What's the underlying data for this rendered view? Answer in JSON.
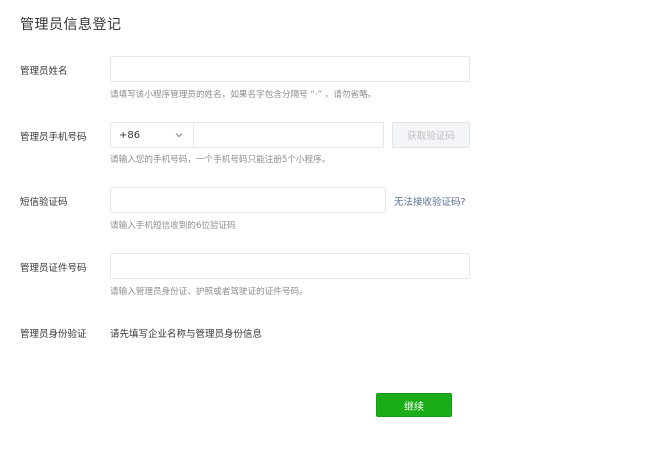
{
  "page": {
    "title": "管理员信息登记"
  },
  "form": {
    "name": {
      "label": "管理员姓名",
      "value": "",
      "hint": "请填写该小程序管理员的姓名，如果名字包含分隔号 “·” ，请勿省略。"
    },
    "phone": {
      "label": "管理员手机号码",
      "country_code": "+86",
      "value": "",
      "get_code_button": "获取验证码",
      "hint": "请输入您的手机号码，一个手机号码只能注册5个小程序。"
    },
    "sms": {
      "label": "短信验证码",
      "value": "",
      "cannot_receive_link": "无法接收验证码?",
      "hint": "请输入手机短信收到的6位验证码"
    },
    "id_number": {
      "label": "管理员证件号码",
      "value": "",
      "hint": "请输入管理员身份证、护照或者驾驶证的证件号码。"
    },
    "identity": {
      "label": "管理员身份验证",
      "text": "请先填写企业名称与管理员身份信息"
    },
    "continue_button": "继续"
  },
  "colors": {
    "primary": "#1aad19",
    "link": "#576b95",
    "hint": "#8d8d8d",
    "border": "#e7e7eb"
  }
}
